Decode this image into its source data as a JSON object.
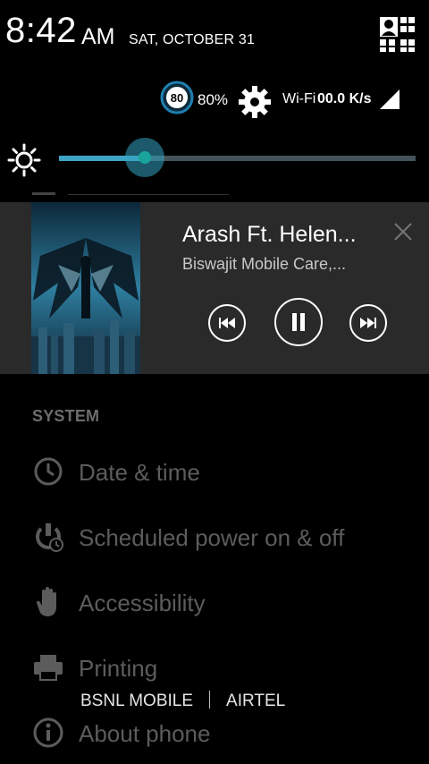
{
  "status": {
    "time": "8:42",
    "ampm": "AM",
    "date": "SAT, OCTOBER 31",
    "battery_badge": "80",
    "battery_percent": "80%",
    "wifi_label": "Wi-Fi",
    "wifi_speed": "00.0 K/s"
  },
  "brightness": {
    "level": 0.24
  },
  "media": {
    "title": "Arash Ft. Helen...",
    "artist": "Biswajit Mobile Care,..."
  },
  "settings": {
    "section": "SYSTEM",
    "items": [
      {
        "label": "Date & time",
        "icon": "clock-icon"
      },
      {
        "label": "Scheduled power on & off",
        "icon": "power-schedule-icon"
      },
      {
        "label": "Accessibility",
        "icon": "hand-icon"
      },
      {
        "label": "Printing",
        "icon": "printer-icon"
      },
      {
        "label": "About phone",
        "icon": "info-icon"
      }
    ]
  },
  "carriers": {
    "left": "BSNL MOBILE",
    "right": "AIRTEL"
  },
  "colors": {
    "accent": "#3fa5c4",
    "card_bg": "#2a2a2a"
  }
}
